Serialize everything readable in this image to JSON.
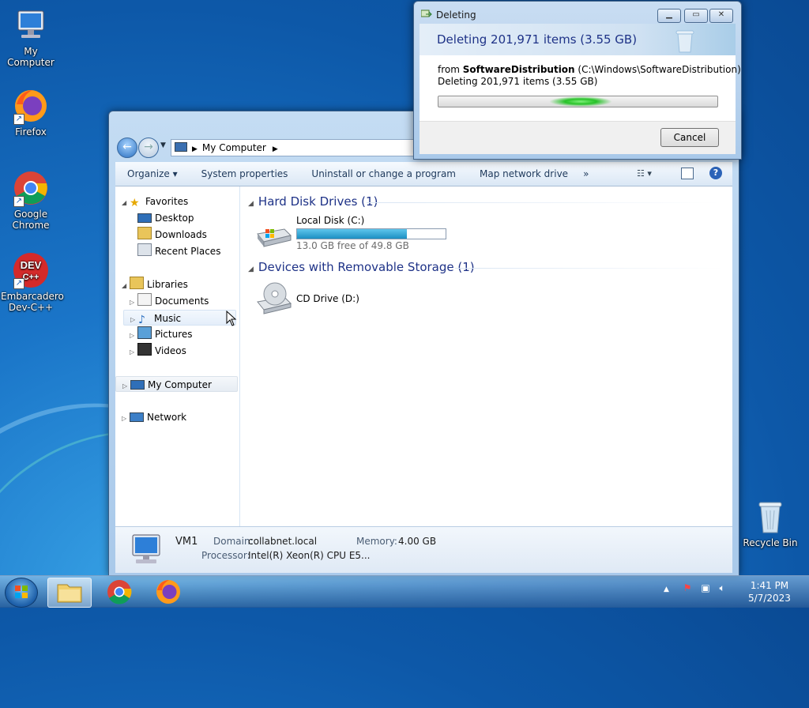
{
  "desktop": {
    "icons": [
      {
        "label": "My Computer"
      },
      {
        "label": "Firefox"
      },
      {
        "label": "Google Chrome"
      },
      {
        "label": "Embarcadero Dev-C++"
      },
      {
        "label": "Recycle Bin"
      }
    ],
    "devcpp_logo_text": "DEV",
    "devcpp_logo_sub": "C++"
  },
  "explorer": {
    "address": {
      "location": "My Computer"
    },
    "toolbar": {
      "organize": "Organize",
      "system_properties": "System properties",
      "uninstall": "Uninstall or change a program",
      "map_drive": "Map network drive",
      "more": "»"
    },
    "nav": {
      "favorites": "Favorites",
      "desktop": "Desktop",
      "downloads": "Downloads",
      "recent_places": "Recent Places",
      "libraries": "Libraries",
      "documents": "Documents",
      "music": "Music",
      "pictures": "Pictures",
      "videos": "Videos",
      "my_computer": "My Computer",
      "network": "Network"
    },
    "groups": {
      "hard_disks": "Hard Disk Drives (1)",
      "removable": "Devices with Removable Storage (1)"
    },
    "drives": {
      "c_name": "Local Disk (C:)",
      "c_free": "13.0 GB free of 49.8 GB",
      "c_used_fraction": 0.739,
      "d_name": "CD Drive (D:)"
    },
    "details": {
      "name": "VM1",
      "domain_label": "Domain:",
      "domain_value": "collabnet.local",
      "memory_label": "Memory:",
      "memory_value": "4.00 GB",
      "processor_label": "Processor:",
      "processor_value": "Intel(R) Xeon(R) CPU E5..."
    }
  },
  "dialog": {
    "title": "Deleting",
    "heading": "Deleting 201,971 items (3.55 GB)",
    "from_prefix": "from ",
    "from_bold": "SoftwareDistribution",
    "from_path": " (C:\\Windows\\SoftwareDistribution)",
    "status": "Deleting 201,971 items (3.55 GB)",
    "cancel": "Cancel"
  },
  "taskbar": {
    "time": "1:41 PM",
    "date": "5/7/2023"
  },
  "colors": {
    "accent": "#1e3287",
    "progress": "#27c228",
    "drive_bar": "#1c8fc2"
  }
}
